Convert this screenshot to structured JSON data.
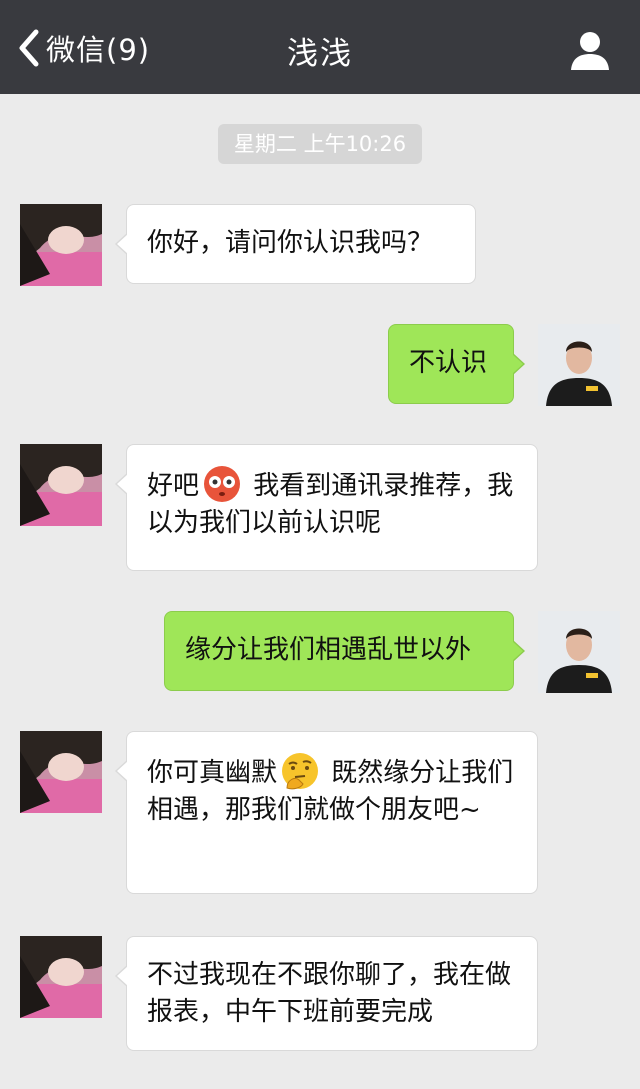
{
  "header": {
    "back_label": "微信(9)",
    "title": "浅浅"
  },
  "timestamp": "星期二 上午10:26",
  "messages": [
    {
      "side": "left",
      "text": "你好，请问你认识我吗？"
    },
    {
      "side": "right",
      "text": "不认识"
    },
    {
      "side": "left",
      "text_before": "好吧",
      "emoji": "flushed-face-icon",
      "text_after": " 我看到通讯录推荐，我以为我们以前认识呢"
    },
    {
      "side": "right",
      "text": "缘分让我们相遇乱世以外"
    },
    {
      "side": "left",
      "text_before": "你可真幽默",
      "emoji": "thinking-face-icon",
      "text_after": " 既然缘分让我们相遇，那我们就做个朋友吧~"
    },
    {
      "side": "left",
      "text": "不过我现在不跟你聊了，我在做报表，中午下班前要完成"
    }
  ],
  "colors": {
    "header_bg": "#393a3f",
    "chat_bg": "#ebebeb",
    "sent_bubble": "#9fe658",
    "received_bubble": "#ffffff"
  }
}
